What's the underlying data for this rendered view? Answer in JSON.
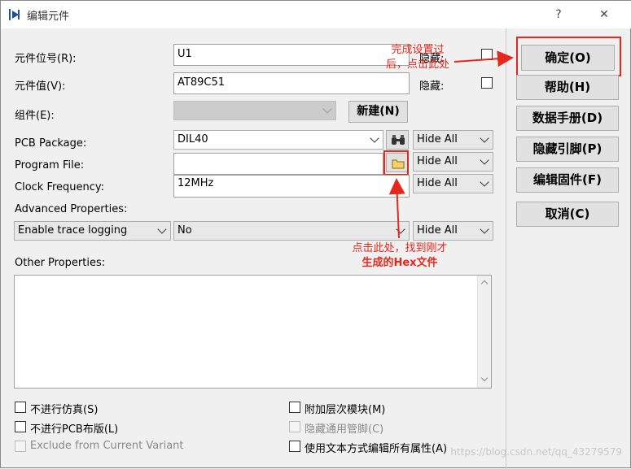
{
  "window": {
    "title": "编辑元件",
    "help_button": "?",
    "close_button": "✕"
  },
  "fields": {
    "ref_label": "元件位号(R):",
    "ref_value": "U1",
    "ref_hidden_label": "隐藏:",
    "value_label": "元件值(V):",
    "value_value": "AT89C51",
    "value_hidden_label": "隐藏:",
    "group_label": "组件(E):",
    "new_button": "新建(N)",
    "pcb_label": "PCB Package:",
    "pcb_value": "DIL40",
    "pcb_hide": "Hide All",
    "program_label": "Program File:",
    "program_value": "",
    "program_hide": "Hide All",
    "clock_label": "Clock Frequency:",
    "clock_value": "12MHz",
    "clock_hide": "Hide All",
    "advanced_label": "Advanced Properties:",
    "advanced_prop": "Enable trace logging",
    "advanced_value": "No",
    "advanced_hide": "Hide All",
    "other_label": "Other Properties:"
  },
  "checkboxes": {
    "no_sim": "不进行仿真(S)",
    "no_pcb": "不进行PCB布版(L)",
    "exclude_variant": "Exclude from Current Variant",
    "attach_hier": "附加层次模块(M)",
    "hide_pins": "隐藏通用管脚(C)",
    "edit_text": "使用文本方式编辑所有属性(A)"
  },
  "side_buttons": {
    "ok": "确定(O)",
    "help": "帮助(H)",
    "datasheet": "数据手册(D)",
    "hidden_pins": "隐藏引脚(P)",
    "firmware": "编辑固件(F)",
    "cancel": "取消(C)"
  },
  "annotations": {
    "top_line1": "完成设置过",
    "top_line2": "后，点击此处",
    "bottom_line1": "点击此处，找到刚才",
    "bottom_line2": "生成的Hex文件"
  },
  "watermark": "https://blog.csdn.net/qq_43279579",
  "colors": {
    "annotation": "#e8261c",
    "background": "#f0f0f0"
  }
}
